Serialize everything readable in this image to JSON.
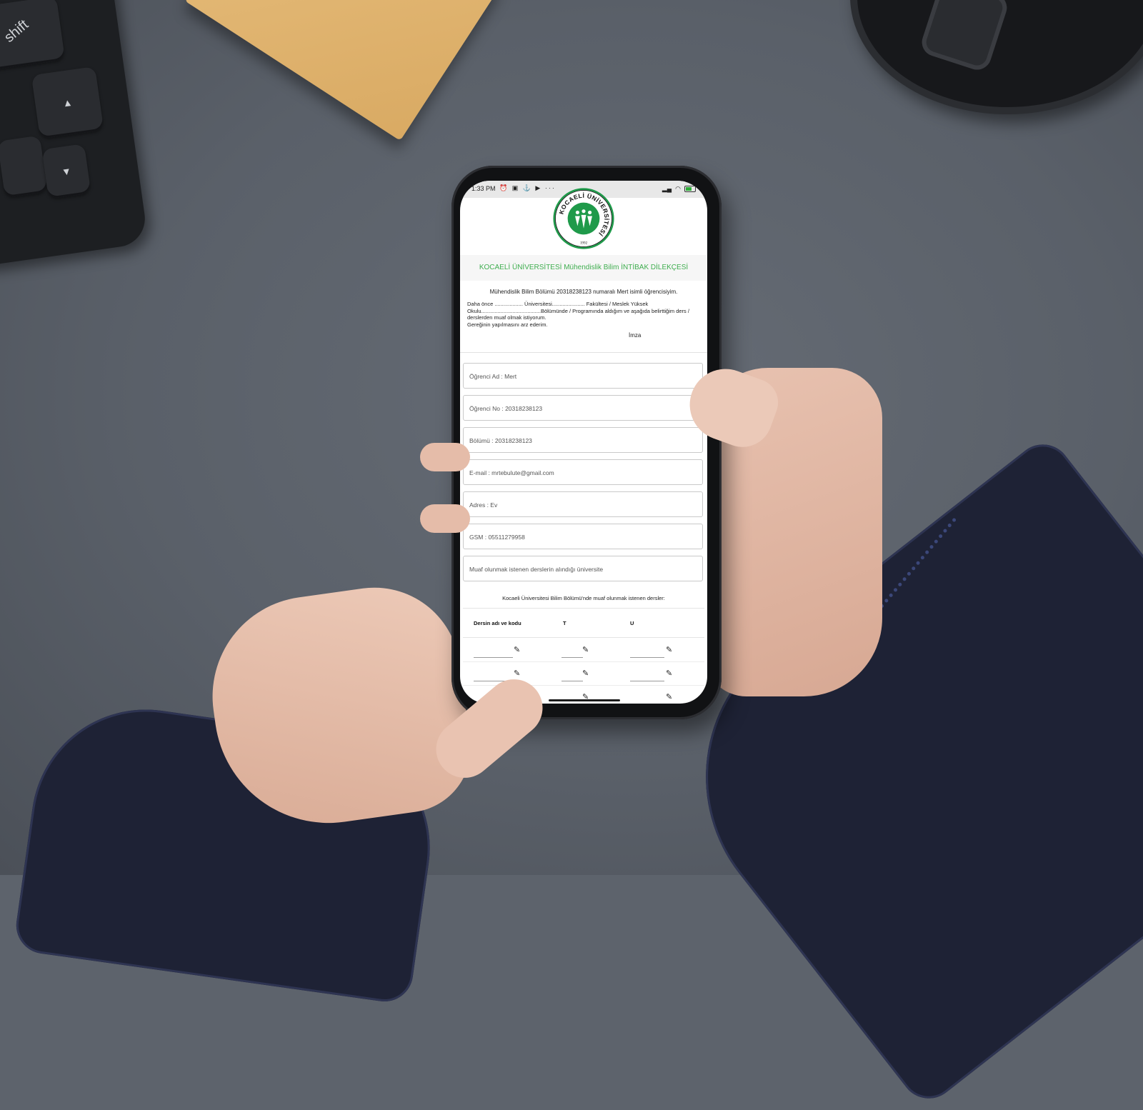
{
  "desk": {
    "keyboard_key_label": "shift"
  },
  "status_bar": {
    "time": "1:33 PM",
    "left_icons": "⏰ ▣ ⚓ ▶ ···",
    "battery_color": "#2fae3a"
  },
  "logo": {
    "ring_text": "KOCAELİ ÜNİVERSİTESİ",
    "year": "1992",
    "color": "#1f9a4a"
  },
  "form": {
    "title": "KOCAELİ ÜNİVERSİTESİ Mühendislik Bilim İNTİBAK DİLEKÇESİ",
    "intro_line": "Mühendislik Bilim  Bölümü 20318238123 numaralı Mert isimli öğrencisiyim.",
    "intro_paragraph": "Daha önce ................... Üniversitesi...................... Fakültesi / Meslek Yüksek Okulu........................................Bölümünde / Programında aldığım ve aşağıda belirttiğim ders / derslerden muaf olmak istiyorum.",
    "closing_line": " Gereğinin yapılmasını arz ederim.",
    "signature_label": "İmza",
    "fields": [
      {
        "label": "Öğrenci Ad : Mert"
      },
      {
        "label": "Öğrenci No : 20318238123"
      },
      {
        "label": "Bölümü : 20318238123"
      },
      {
        "label": "E-mail : mrtebulute@gmail.com"
      },
      {
        "label": "Adres : Ev"
      },
      {
        "label": "GSM : 05511279958"
      },
      {
        "label": "Muaf olunmak istenen derslerin alındığı üniversite"
      }
    ],
    "table": {
      "caption": "Kocaeli Üniversitesi Bilim Bölümü'nde muaf olunmak istenen dersler:",
      "headers": [
        "Dersin adı ve kodu",
        "T",
        "U"
      ],
      "edit_icon": "pencil-icon"
    }
  }
}
